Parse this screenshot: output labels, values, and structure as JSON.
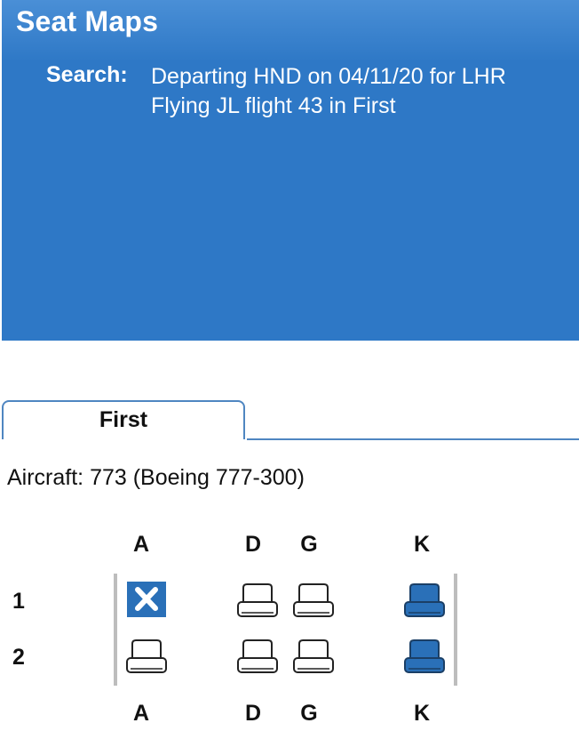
{
  "header": {
    "title": "Seat Maps",
    "search_label": "Search:",
    "search_line1": "Departing HND on 04/11/20 for LHR",
    "search_line2": "Flying JL flight 43 in First"
  },
  "tabs": [
    {
      "label": "First",
      "active": true
    }
  ],
  "aircraft": {
    "text": "Aircraft: 773 (Boeing 777-300)"
  },
  "seatmap": {
    "columns_top": [
      "A",
      "D",
      "G",
      "K"
    ],
    "columns_bottom": [
      "A",
      "D",
      "G",
      "K"
    ],
    "rows": [
      {
        "label": "1",
        "seats": [
          {
            "id": "1A",
            "status": "unavailable"
          },
          {
            "id": "1D",
            "status": "available"
          },
          {
            "id": "1G",
            "status": "available"
          },
          {
            "id": "1K",
            "status": "premium"
          }
        ]
      },
      {
        "label": "2",
        "seats": [
          {
            "id": "2A",
            "status": "available"
          },
          {
            "id": "2D",
            "status": "available"
          },
          {
            "id": "2G",
            "status": "available"
          },
          {
            "id": "2K",
            "status": "premium"
          }
        ]
      }
    ]
  },
  "colors": {
    "header_bg": "#2e78c6",
    "tab_border": "#4f86c1",
    "seat_filled": "#2a70b8",
    "seat_outline": "#222222",
    "cabin_wall": "#bdbdbd"
  }
}
